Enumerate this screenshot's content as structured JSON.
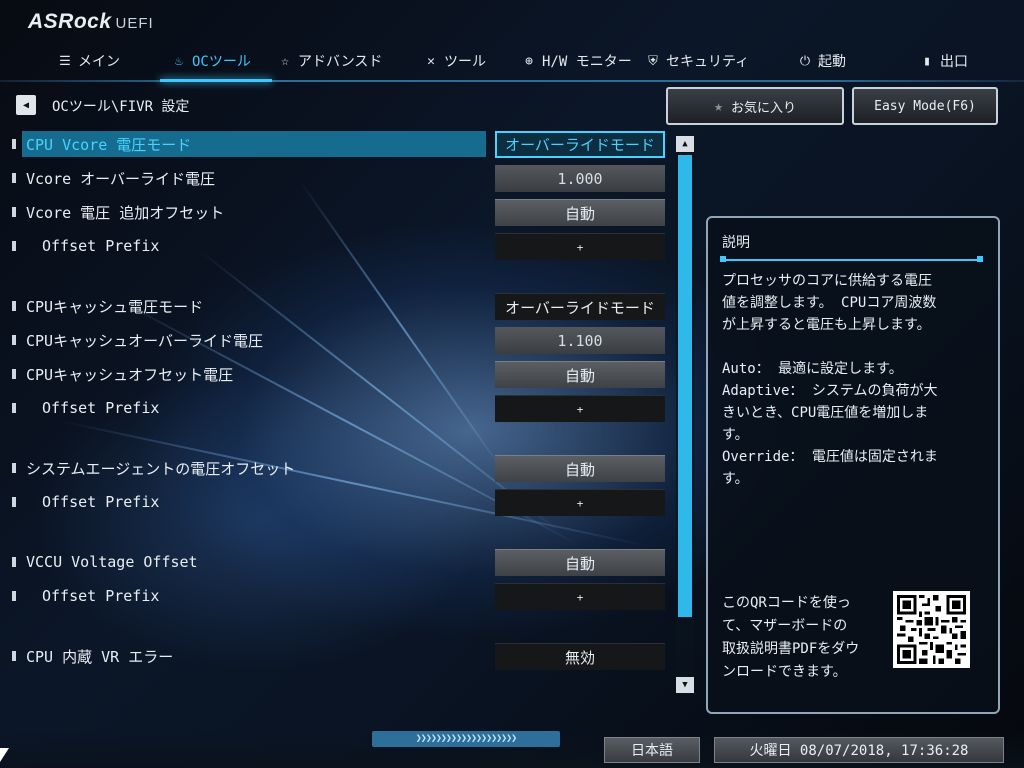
{
  "header": {
    "logo": "ASRock",
    "logo_suffix": "UEFI",
    "tabs": [
      {
        "label": "メイン",
        "icon": "list-icon"
      },
      {
        "label": "OCツール",
        "icon": "flame-icon",
        "active": true
      },
      {
        "label": "アドバンスド",
        "icon": "star-icon"
      },
      {
        "label": "ツール",
        "icon": "wrench-icon"
      },
      {
        "label": "H/W モニター",
        "icon": "crosshair-icon"
      },
      {
        "label": "セキュリティ",
        "icon": "shield-icon"
      },
      {
        "label": "起動",
        "icon": "power-icon"
      },
      {
        "label": "出口",
        "icon": "exit-door-icon"
      }
    ]
  },
  "breadcrumb": "OCツール\\FIVR 設定",
  "buttons": {
    "favorites": "お気に入り",
    "easy_mode": "Easy Mode(F6)"
  },
  "settings": [
    {
      "label": "CPU Vcore 電圧モード",
      "value": "オーバーライドモード"
    },
    {
      "label": "Vcore オーバーライド電圧",
      "value": "1.000"
    },
    {
      "label": "Vcore 電圧 追加オフセット",
      "value": "自動"
    },
    {
      "label": "Offset Prefix",
      "value": "+"
    },
    {
      "label": "CPUキャッシュ電圧モード",
      "value": "オーバーライドモード"
    },
    {
      "label": "CPUキャッシュオーバーライド電圧",
      "value": "1.100"
    },
    {
      "label": "CPUキャッシュオフセット電圧",
      "value": "自動"
    },
    {
      "label": "Offset Prefix",
      "value": "+"
    },
    {
      "label": "システムエージェントの電圧オフセット",
      "value": "自動"
    },
    {
      "label": "Offset Prefix",
      "value": "+"
    },
    {
      "label": "VCCU Voltage Offset",
      "value": "自動"
    },
    {
      "label": "Offset Prefix",
      "value": "+"
    },
    {
      "label": "CPU 内蔵 VR エラー",
      "value": "無効"
    }
  ],
  "description": {
    "title": "説明",
    "body": "プロセッサのコアに供給する電圧\n値を調整します。 CPUコア周波数\nが上昇すると電圧も上昇します。\n\nAuto： 最適に設定します。\nAdaptive： システムの負荷が大\nきいとき、CPU電圧値を増加しま\nす。\nOverride： 電圧値は固定されま\nす。",
    "qr_text": "このQRコードを使っ\nて、マザーボードの\n取扱説明書PDFをダウ\nンロードできます。"
  },
  "footer": {
    "language": "日本語",
    "datetime": "火曜日 08/07/2018, 17:36:28"
  },
  "colors": {
    "accent": "#3ec8ff",
    "selected_row": "#166c8f"
  }
}
